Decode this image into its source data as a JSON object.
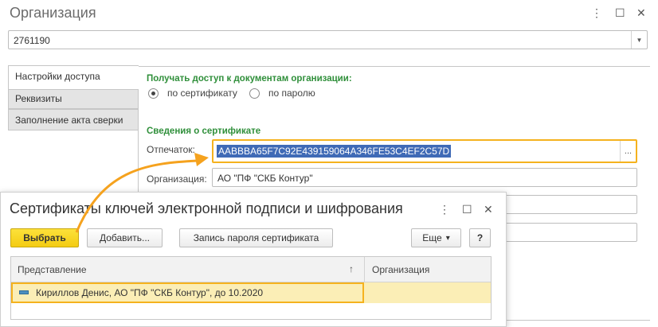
{
  "window": {
    "title": "Организация",
    "more_icon": "⋮",
    "maximize_icon": "☐",
    "close_icon": "✕"
  },
  "org_select": {
    "value": "2761190",
    "dropdown_icon": "▼"
  },
  "tabs": [
    {
      "label": "Настройки доступа"
    },
    {
      "label": "Реквизиты"
    },
    {
      "label": "Заполнение акта сверки"
    }
  ],
  "access": {
    "heading": "Получать доступ к документам организации:",
    "option_certificate": "по сертификату",
    "option_password": "по паролю",
    "selected": "certificate"
  },
  "cert_info": {
    "heading": "Сведения о сертификате",
    "thumbprint_label": "Отпечаток:",
    "thumbprint_value": "AABBBA65F7C92E439159064A346FE53C4EF2C57D",
    "thumbprint_btn": "...",
    "org_label": "Организация:",
    "org_value": "АО \"ПФ \"СКБ Контур\""
  },
  "dialog": {
    "title": "Сертификаты ключей электронной подписи и шифрования",
    "more_icon": "⋮",
    "maximize_icon": "☐",
    "close_icon": "✕",
    "buttons": {
      "select": "Выбрать",
      "add": "Добавить...",
      "save_password": "Запись пароля сертификата",
      "more": "Еще",
      "more_caret": "▾",
      "help": "?"
    },
    "table": {
      "columns": [
        "Представление",
        "Организация"
      ],
      "sort_icon": "↑",
      "rows": [
        {
          "name": "Кириллов Денис, АО \"ПФ \"СКБ Контур\", до 10.2020",
          "org": ""
        }
      ]
    }
  },
  "colors": {
    "accent_yellow": "#f5b21e",
    "green_heading": "#2f8f3a",
    "selection_blue": "#3f6ab6",
    "arrow": "#f5a21e"
  }
}
